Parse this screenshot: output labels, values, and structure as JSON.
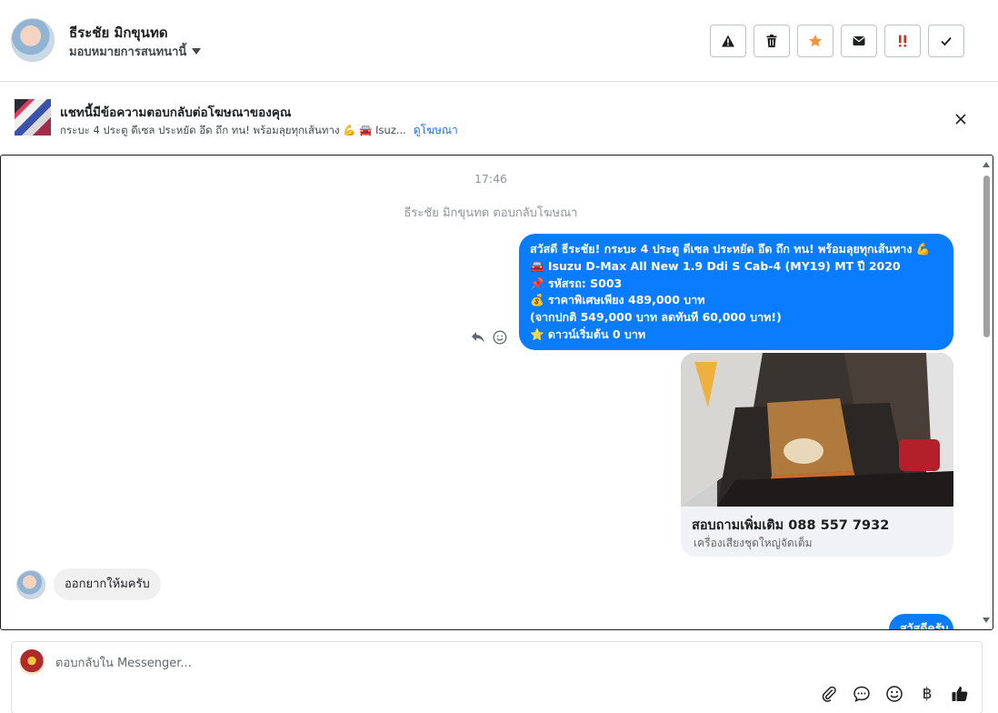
{
  "header": {
    "contact_name": "ธีระชัย มิกขุนทด",
    "assign_label": "มอบหมายการสนทนานี้",
    "actions": [
      {
        "name": "spam-button",
        "icon": "warning-icon",
        "color": "#1c1e21"
      },
      {
        "name": "delete-button",
        "icon": "trash-icon",
        "color": "#1c1e21"
      },
      {
        "name": "star-button",
        "icon": "star-icon",
        "color": "#f7923b"
      },
      {
        "name": "unread-button",
        "icon": "envelope-icon",
        "color": "#1c1e21"
      },
      {
        "name": "follow-up-button",
        "icon": "exclamation-icon",
        "color": "#d0311f"
      },
      {
        "name": "done-button",
        "icon": "checkmark-icon",
        "color": "#1c1e21"
      }
    ]
  },
  "banner": {
    "title": "แชทนี้มีข้อความตอบกลับต่อโฆษณาของคุณ",
    "subtitle": "กระบะ 4 ประตู ดีเซล ประหยัด อึด ถึก ทน! พร้อมลุยทุกเส้นทาง 💪 🚘 Isuz...",
    "link": "ดูโฆษณา"
  },
  "conversation": {
    "timestamp": "17:46",
    "system_note": "ธีระชัย มิกขุนทด ตอบกลับโฆษณา",
    "outgoing_lines": [
      "สวัสดี ธีระชัย! กระบะ 4 ประตู ดีเซล ประหยัด อึด ถึก ทน! พร้อมลุยทุกเส้นทาง 💪",
      "🚘 Isuzu D-Max All New 1.9 Ddi S Cab-4 (MY19) MT ปี 2020",
      "📌 รหัสรถ: S003",
      "💰 ราคาพิเศษเพียง 489,000 บาท",
      "(จากปกติ 549,000 บาท ลดทันที 60,000 บาท!)",
      "⭐ ดาวน์เริ่มต้น 0 บาท"
    ],
    "ad_card": {
      "title": "สอบถามเพิ่มเติม 088 557 7932",
      "subtitle": "เครื่องเสียงชุดใหญ่จัดเต็ม"
    },
    "incoming_message": "ออกยากให้มครับ",
    "partial_outgoing": "สวัสดีครับ"
  },
  "composer": {
    "placeholder": "ตอบกลับใน Messenger...",
    "baht_symbol": "฿",
    "tools": [
      "paperclip-icon",
      "chat-bubble-icon",
      "smiley-icon",
      "baht-icon",
      "thumbs-up-icon"
    ]
  },
  "colors": {
    "accent": "#0a7cff",
    "link": "#216fdb",
    "star": "#f7923b",
    "alert": "#d0311f"
  }
}
